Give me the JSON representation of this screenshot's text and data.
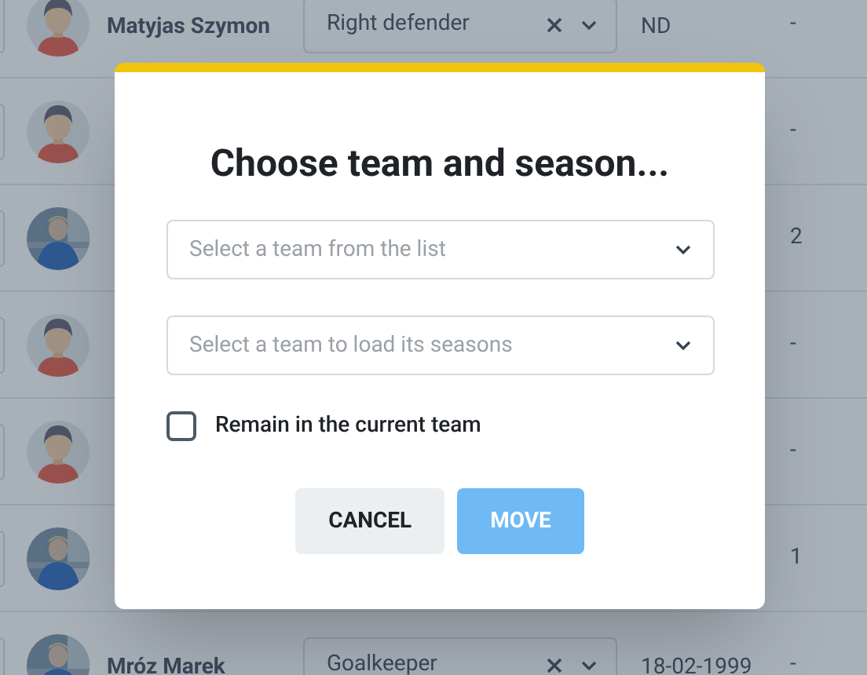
{
  "players": [
    {
      "kind": "cartoon",
      "name": "Matyjas Szymon",
      "position": "Right defender",
      "date": "ND",
      "number": "-"
    },
    {
      "kind": "cartoon",
      "number": "-"
    },
    {
      "number": "2"
    },
    {
      "kind": "cartoon",
      "number": "-"
    },
    {
      "kind": "cartoon",
      "number": "-"
    },
    {
      "number": "1"
    },
    {
      "name": "Mróz Marek",
      "position": "Goalkeeper",
      "date": "18-02-1999",
      "number": "-"
    }
  ],
  "dialog": {
    "title": "Choose team and season...",
    "fields": [
      {
        "placeholder": "Select a team from the list"
      },
      {
        "placeholder": "Select a team to load its seasons"
      }
    ],
    "checkbox": {
      "label": "Remain in the current team",
      "checked": false
    },
    "buttons": [
      {
        "label": "CANCEL",
        "kind": "secondary",
        "disabled": false
      },
      {
        "label": "MOVE",
        "kind": "primary",
        "disabled": true
      }
    ]
  }
}
